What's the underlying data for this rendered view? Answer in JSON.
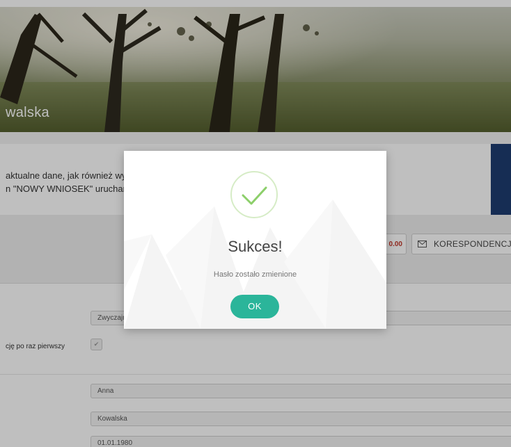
{
  "profile": {
    "name_partial": "walska"
  },
  "info": {
    "line1": "aktualne dane, jak również wys",
    "line2": "n \"NOWY WNIOSEK\" uruchamia"
  },
  "toolbar": {
    "amount": "0.00",
    "correspondence_label": "KORESPONDENCJA"
  },
  "form": {
    "select_value": "Zwyczajny",
    "checkbox_label": "cję po raz pierwszy",
    "checkbox_checked": true,
    "first_name": "Anna",
    "last_name": "Kowalska",
    "birth_date": "01.01.1980"
  },
  "modal": {
    "title": "Sukces!",
    "message": "Hasło zostało zmienione",
    "ok_label": "OK",
    "icon": "checkmark-icon",
    "accent_color": "#2bb59a"
  }
}
